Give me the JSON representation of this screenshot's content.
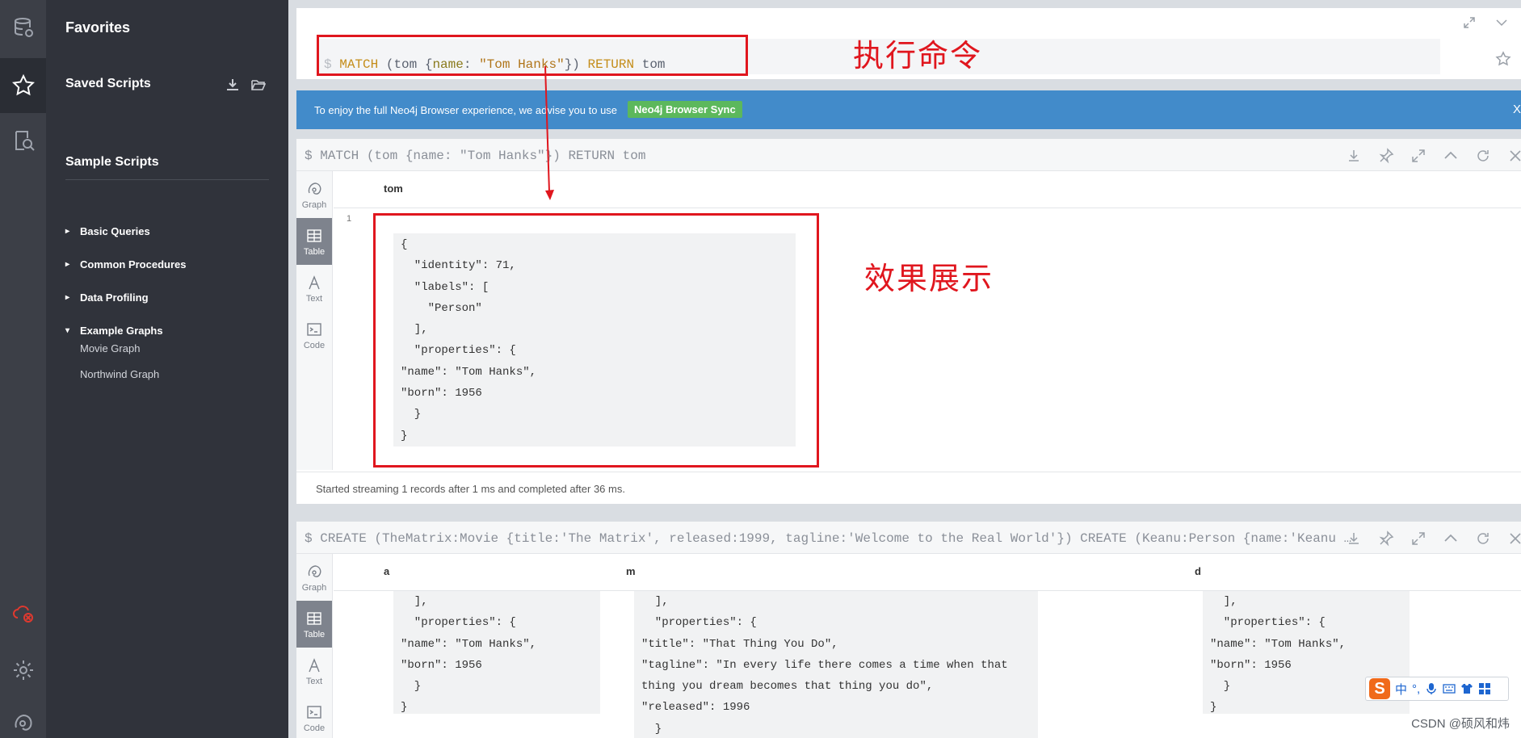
{
  "drawer": {
    "title": "Favorites",
    "saved_scripts": "Saved Scripts",
    "sample_scripts": "Sample Scripts",
    "groups": [
      {
        "label": "Basic Queries",
        "caret": "▸"
      },
      {
        "label": "Common Procedures",
        "caret": "▸"
      },
      {
        "label": "Data Profiling",
        "caret": "▸"
      },
      {
        "label": "Example Graphs",
        "caret": "▾"
      }
    ],
    "example_graphs": [
      {
        "label": "Movie Graph"
      },
      {
        "label": "Northwind Graph"
      }
    ]
  },
  "editor": {
    "prompt": "$",
    "query_kw1": "MATCH",
    "query_mid1": " (tom {",
    "query_prop": "name",
    "query_mid2": ": ",
    "query_str": "\"Tom Hanks\"",
    "query_mid3": "}) ",
    "query_kw2": "RETURN",
    "query_end": " tom"
  },
  "banner": {
    "message": "To enjoy the full Neo4j Browser experience, we advise you to use",
    "sync_label": "Neo4j Browser Sync",
    "close": "X"
  },
  "frame1": {
    "title": "$ MATCH (tom {name: \"Tom Hanks\"}) RETURN tom",
    "tabs": [
      "Graph",
      "Table",
      "Text",
      "Code"
    ],
    "column": "tom",
    "row_number": "1",
    "json": "{\n  \"identity\": 71,\n  \"labels\": [\n    \"Person\"\n  ],\n  \"properties\": {\n\"name\": \"Tom Hanks\",\n\"born\": 1956\n  }\n}",
    "status": "Started streaming 1 records after 1 ms and completed after 36 ms."
  },
  "frame2": {
    "title": "$ CREATE (TheMatrix:Movie {title:'The Matrix', released:1999, tagline:'Welcome to the Real World'}) CREATE (Keanu:Person {name:'Keanu …",
    "tabs": [
      "Graph",
      "Table",
      "Text",
      "Code"
    ],
    "columns": [
      "a",
      "m",
      "d"
    ],
    "json_a": "  ],\n  \"properties\": {\n\"name\": \"Tom Hanks\",\n\"born\": 1956\n  }\n}",
    "json_m": "  ],\n  \"properties\": {\n\"title\": \"That Thing You Do\",\n\"tagline\": \"In every life there comes a time when that\nthing you dream becomes that thing you do\",\n\"released\": 1996\n  }",
    "json_d": "  ],\n  \"properties\": {\n\"name\": \"Tom Hanks\",\n\"born\": 1956\n  }\n}"
  },
  "annotations": {
    "command_note": "执行命令",
    "result_note": "效果展示"
  },
  "ime": {
    "logo": "S",
    "lang": "中",
    "punct": "°,"
  },
  "watermark": "CSDN @硕风和炜",
  "colors": {
    "annotation": "#e0161e",
    "banner": "#428bca",
    "sync": "#5cb85c",
    "rail": "#3c3f47",
    "drawer": "#30333b"
  }
}
